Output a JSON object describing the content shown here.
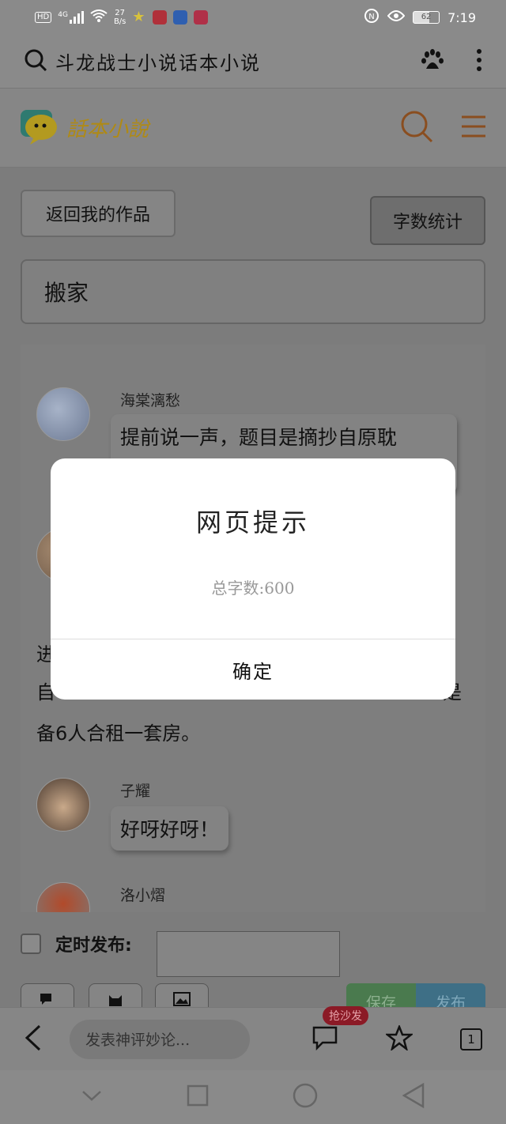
{
  "status_bar": {
    "hd": "HD",
    "signal": "4G",
    "net_speed_value": "27",
    "net_speed_unit": "B/s",
    "battery": "62",
    "time": "7:19"
  },
  "browser": {
    "search_query": "斗龙战士小说话本小说"
  },
  "site": {
    "logo_text": "話本小說"
  },
  "page": {
    "back_button": "返回我的作品",
    "wordcount_button": "字数统计",
    "title_value": "搬家",
    "messages": [
      {
        "user": "海棠漓愁",
        "text": "提前说一声，题目是摘抄自原耽"
      },
      {
        "user": "子耀",
        "text": "好呀好呀！"
      },
      {
        "user": "洛小熠",
        "text": ""
      }
    ],
    "paragraph_lines": [
      "进",
      "自",
      "备6人合租一套房。"
    ],
    "paragraph_tail": "是",
    "schedule_label": "定时发布:",
    "save_button": "保存",
    "publish_button": "发布"
  },
  "bottom_bar": {
    "comment_placeholder": "发表神评妙论...",
    "sofa_badge": "抢沙发",
    "tab_count": "1"
  },
  "dialog": {
    "title": "网页提示",
    "message": "总字数:600",
    "ok": "确定"
  }
}
